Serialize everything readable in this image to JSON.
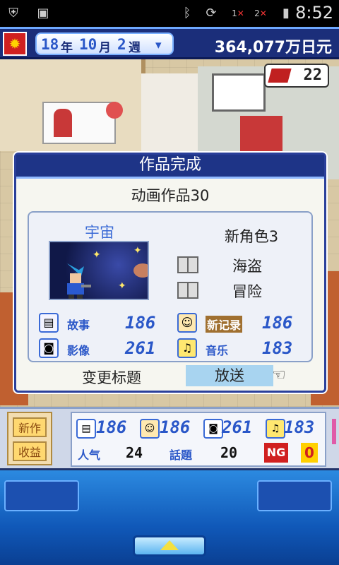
{
  "status_bar": {
    "time": "8:52",
    "signal_labels": [
      "1",
      "2"
    ]
  },
  "header": {
    "year": "18",
    "year_unit": "年",
    "month": "10",
    "month_unit": "月",
    "week": "2",
    "week_unit": "週",
    "money": "364,077万日元"
  },
  "world": {
    "counter_value": "22"
  },
  "dialog": {
    "title": "作品完成",
    "subtitle": "动画作品30",
    "work_name": "宇宙",
    "new_role": "新角色3",
    "genres": [
      "海盗",
      "冒险"
    ],
    "stats": {
      "story_label": "故事",
      "story_value": "186",
      "record_label": "新记录",
      "record_value": "186",
      "visual_label": "影像",
      "visual_value": "261",
      "music_label": "音乐",
      "music_value": "183"
    },
    "rename_label": "变更标题",
    "broadcast_label": "放送"
  },
  "info_strip": {
    "side_new": "新作",
    "side_income": "收益",
    "values": [
      "186",
      "186",
      "261",
      "183"
    ],
    "popularity_label": "人气",
    "popularity_value": "24",
    "topic_label": "話題",
    "topic_value": "20",
    "ng_label": "NG",
    "ng_value": "0"
  },
  "colors": {
    "header_bg": "#1b2e7a",
    "dialog_title_bg": "#1e3487",
    "stat_blue": "#2a57c8",
    "broadcast_bg": "#a8d4f0",
    "panel_blue": "#1058b8"
  }
}
